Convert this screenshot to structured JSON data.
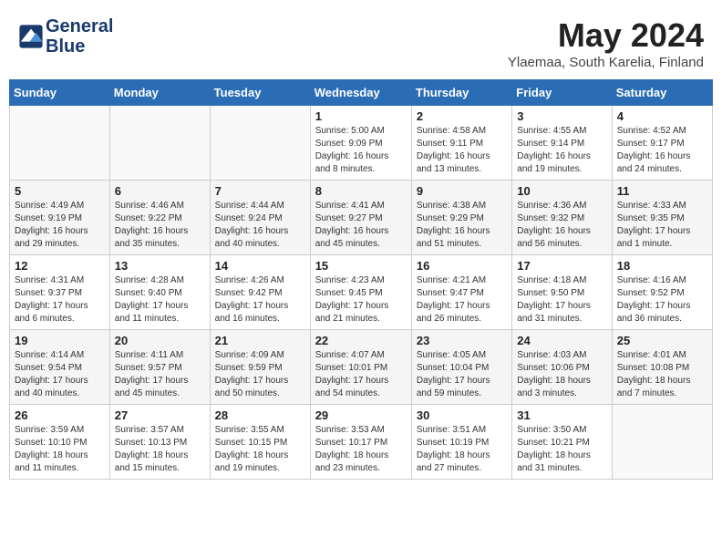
{
  "header": {
    "logo_line1": "General",
    "logo_line2": "Blue",
    "month": "May 2024",
    "location": "Ylaemaa, South Karelia, Finland"
  },
  "weekdays": [
    "Sunday",
    "Monday",
    "Tuesday",
    "Wednesday",
    "Thursday",
    "Friday",
    "Saturday"
  ],
  "weeks": [
    [
      {
        "day": "",
        "info": ""
      },
      {
        "day": "",
        "info": ""
      },
      {
        "day": "",
        "info": ""
      },
      {
        "day": "1",
        "info": "Sunrise: 5:00 AM\nSunset: 9:09 PM\nDaylight: 16 hours\nand 8 minutes."
      },
      {
        "day": "2",
        "info": "Sunrise: 4:58 AM\nSunset: 9:11 PM\nDaylight: 16 hours\nand 13 minutes."
      },
      {
        "day": "3",
        "info": "Sunrise: 4:55 AM\nSunset: 9:14 PM\nDaylight: 16 hours\nand 19 minutes."
      },
      {
        "day": "4",
        "info": "Sunrise: 4:52 AM\nSunset: 9:17 PM\nDaylight: 16 hours\nand 24 minutes."
      }
    ],
    [
      {
        "day": "5",
        "info": "Sunrise: 4:49 AM\nSunset: 9:19 PM\nDaylight: 16 hours\nand 29 minutes."
      },
      {
        "day": "6",
        "info": "Sunrise: 4:46 AM\nSunset: 9:22 PM\nDaylight: 16 hours\nand 35 minutes."
      },
      {
        "day": "7",
        "info": "Sunrise: 4:44 AM\nSunset: 9:24 PM\nDaylight: 16 hours\nand 40 minutes."
      },
      {
        "day": "8",
        "info": "Sunrise: 4:41 AM\nSunset: 9:27 PM\nDaylight: 16 hours\nand 45 minutes."
      },
      {
        "day": "9",
        "info": "Sunrise: 4:38 AM\nSunset: 9:29 PM\nDaylight: 16 hours\nand 51 minutes."
      },
      {
        "day": "10",
        "info": "Sunrise: 4:36 AM\nSunset: 9:32 PM\nDaylight: 16 hours\nand 56 minutes."
      },
      {
        "day": "11",
        "info": "Sunrise: 4:33 AM\nSunset: 9:35 PM\nDaylight: 17 hours\nand 1 minute."
      }
    ],
    [
      {
        "day": "12",
        "info": "Sunrise: 4:31 AM\nSunset: 9:37 PM\nDaylight: 17 hours\nand 6 minutes."
      },
      {
        "day": "13",
        "info": "Sunrise: 4:28 AM\nSunset: 9:40 PM\nDaylight: 17 hours\nand 11 minutes."
      },
      {
        "day": "14",
        "info": "Sunrise: 4:26 AM\nSunset: 9:42 PM\nDaylight: 17 hours\nand 16 minutes."
      },
      {
        "day": "15",
        "info": "Sunrise: 4:23 AM\nSunset: 9:45 PM\nDaylight: 17 hours\nand 21 minutes."
      },
      {
        "day": "16",
        "info": "Sunrise: 4:21 AM\nSunset: 9:47 PM\nDaylight: 17 hours\nand 26 minutes."
      },
      {
        "day": "17",
        "info": "Sunrise: 4:18 AM\nSunset: 9:50 PM\nDaylight: 17 hours\nand 31 minutes."
      },
      {
        "day": "18",
        "info": "Sunrise: 4:16 AM\nSunset: 9:52 PM\nDaylight: 17 hours\nand 36 minutes."
      }
    ],
    [
      {
        "day": "19",
        "info": "Sunrise: 4:14 AM\nSunset: 9:54 PM\nDaylight: 17 hours\nand 40 minutes."
      },
      {
        "day": "20",
        "info": "Sunrise: 4:11 AM\nSunset: 9:57 PM\nDaylight: 17 hours\nand 45 minutes."
      },
      {
        "day": "21",
        "info": "Sunrise: 4:09 AM\nSunset: 9:59 PM\nDaylight: 17 hours\nand 50 minutes."
      },
      {
        "day": "22",
        "info": "Sunrise: 4:07 AM\nSunset: 10:01 PM\nDaylight: 17 hours\nand 54 minutes."
      },
      {
        "day": "23",
        "info": "Sunrise: 4:05 AM\nSunset: 10:04 PM\nDaylight: 17 hours\nand 59 minutes."
      },
      {
        "day": "24",
        "info": "Sunrise: 4:03 AM\nSunset: 10:06 PM\nDaylight: 18 hours\nand 3 minutes."
      },
      {
        "day": "25",
        "info": "Sunrise: 4:01 AM\nSunset: 10:08 PM\nDaylight: 18 hours\nand 7 minutes."
      }
    ],
    [
      {
        "day": "26",
        "info": "Sunrise: 3:59 AM\nSunset: 10:10 PM\nDaylight: 18 hours\nand 11 minutes."
      },
      {
        "day": "27",
        "info": "Sunrise: 3:57 AM\nSunset: 10:13 PM\nDaylight: 18 hours\nand 15 minutes."
      },
      {
        "day": "28",
        "info": "Sunrise: 3:55 AM\nSunset: 10:15 PM\nDaylight: 18 hours\nand 19 minutes."
      },
      {
        "day": "29",
        "info": "Sunrise: 3:53 AM\nSunset: 10:17 PM\nDaylight: 18 hours\nand 23 minutes."
      },
      {
        "day": "30",
        "info": "Sunrise: 3:51 AM\nSunset: 10:19 PM\nDaylight: 18 hours\nand 27 minutes."
      },
      {
        "day": "31",
        "info": "Sunrise: 3:50 AM\nSunset: 10:21 PM\nDaylight: 18 hours\nand 31 minutes."
      },
      {
        "day": "",
        "info": ""
      }
    ]
  ]
}
